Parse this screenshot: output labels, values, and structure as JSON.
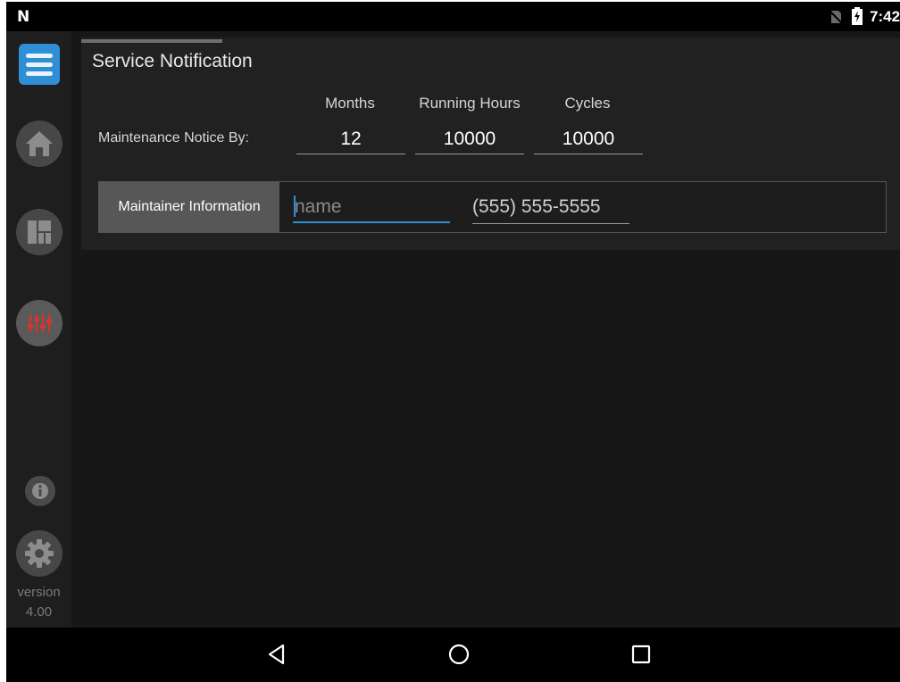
{
  "status_bar": {
    "logo": "N",
    "time": "7:42"
  },
  "sidebar": {
    "items": [
      {
        "name": "menu",
        "icon": "hamburger-menu-icon"
      },
      {
        "name": "home",
        "icon": "home-icon"
      },
      {
        "name": "dashboard",
        "icon": "dashboard-icon"
      },
      {
        "name": "settings-sliders",
        "icon": "sliders-icon"
      },
      {
        "name": "info",
        "icon": "info-icon"
      },
      {
        "name": "gear",
        "icon": "gear-icon"
      }
    ],
    "version_label": "version",
    "version_number": "4.00"
  },
  "panel": {
    "title": "Service Notification",
    "notice_label": "Maintenance Notice By:",
    "columns": [
      "Months",
      "Running Hours",
      "Cycles"
    ],
    "values": {
      "months": "12",
      "running_hours": "10000",
      "cycles": "10000"
    },
    "maintainer": {
      "label": "Maintainer Information",
      "name_placeholder": "name",
      "phone_value": "(555) 555-5555"
    }
  },
  "nav_bar": {
    "icons": [
      "back-icon",
      "home-circle-icon",
      "recents-icon"
    ]
  },
  "colors": {
    "accent": "#2f8fd6",
    "slider_accent": "#d9342b",
    "background": "#171717",
    "panel": "#212121"
  }
}
